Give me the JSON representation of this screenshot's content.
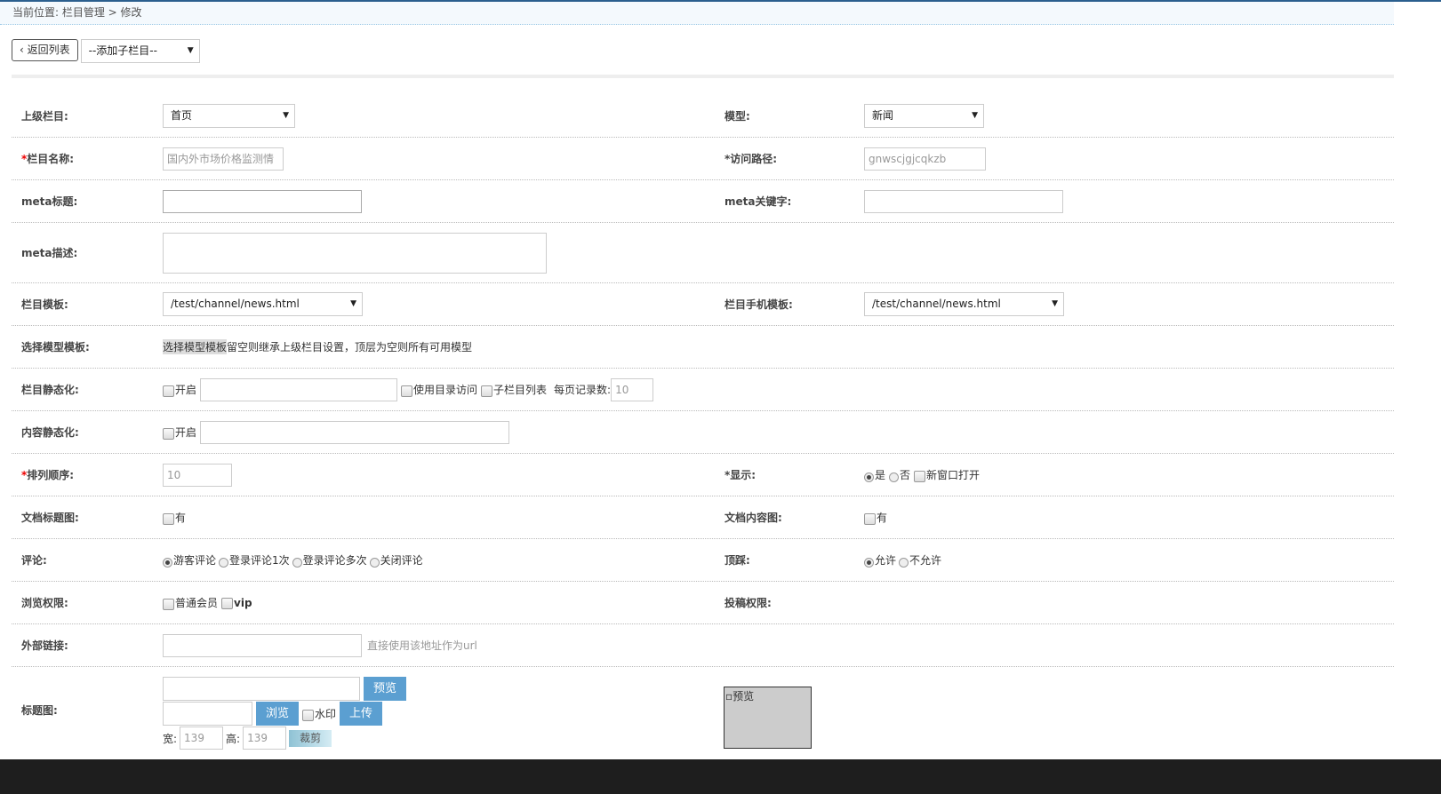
{
  "breadcrumb": "当前位置: 栏目管理 > 修改",
  "toolbar": {
    "back": "返回列表",
    "add_child": "--添加子栏目--"
  },
  "form": {
    "parent": {
      "label": "上级栏目:",
      "value": "首页"
    },
    "model": {
      "label": "模型:",
      "value": "新闻"
    },
    "name": {
      "label": "栏目名称:",
      "value": "国内外市场价格监测情"
    },
    "path": {
      "label": "访问路径:",
      "value": "gnwscjgjcqkzb"
    },
    "meta_title": {
      "label": "meta标题:"
    },
    "meta_keywords": {
      "label": "meta关键字:"
    },
    "meta_desc": {
      "label": "meta描述:"
    },
    "tpl": {
      "label": "栏目模板:",
      "value": "/test/channel/news.html"
    },
    "mobile_tpl": {
      "label": "栏目手机模板:",
      "value": "/test/channel/news.html"
    },
    "model_tpl": {
      "label": "选择模型模板:",
      "link": "选择模型模板",
      "hint": "留空则继承上级栏目设置，顶层为空则所有可用模型"
    },
    "static": {
      "label": "栏目静态化:",
      "enable": "开启",
      "dir": "使用目录访问",
      "sublist": "子栏目列表",
      "per_page_label": "每页记录数:",
      "per_page": "10"
    },
    "content_static": {
      "label": "内容静态化:",
      "enable": "开启"
    },
    "order": {
      "label": "排列顺序:",
      "value": "10"
    },
    "display": {
      "label": "显示:",
      "yes": "是",
      "no": "否",
      "new_window": "新窗口打开"
    },
    "title_img": {
      "label": "文档标题图:",
      "has": "有"
    },
    "content_img": {
      "label": "文档内容图:",
      "has": "有"
    },
    "comment": {
      "label": "评论:",
      "options": [
        "游客评论",
        "登录评论1次",
        "登录评论多次",
        "关闭评论"
      ]
    },
    "updown": {
      "label": "顶踩:",
      "options": [
        "允许",
        "不允许"
      ]
    },
    "view_perm": {
      "label": "浏览权限:",
      "options": [
        "普通会员",
        "vip"
      ]
    },
    "submit_perm": {
      "label": "投稿权限:"
    },
    "link": {
      "label": "外部链接:",
      "hint": "直接使用该地址作为url"
    },
    "image": {
      "label": "标题图:",
      "preview": "预览",
      "browse": "浏览",
      "watermark": "水印",
      "upload": "上传",
      "width_label": "宽:",
      "width": "139",
      "height_label": "高:",
      "height": "139",
      "crop": "裁剪",
      "preview_alt": "预览"
    }
  }
}
